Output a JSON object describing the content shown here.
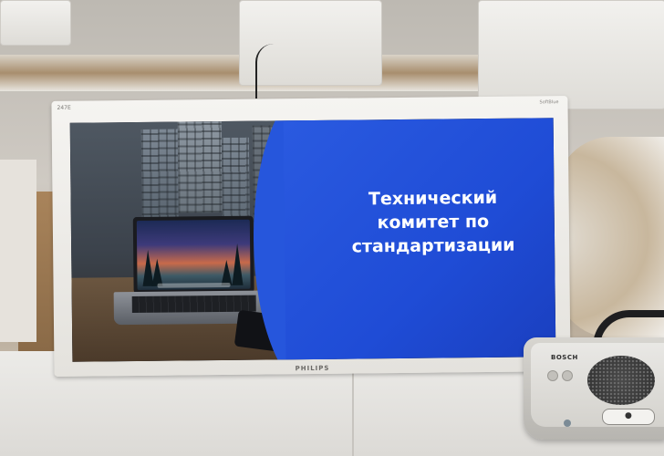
{
  "monitor": {
    "model_label": "247E",
    "tag_label": "SoftBlue",
    "brand": "PHILIPS"
  },
  "slide": {
    "title": "Технический\nкомитет по\nстандартизации",
    "accent_color": "#2656dc"
  },
  "microphone": {
    "brand": "BOSCH",
    "talk_button_icon": "person-speak-icon"
  }
}
